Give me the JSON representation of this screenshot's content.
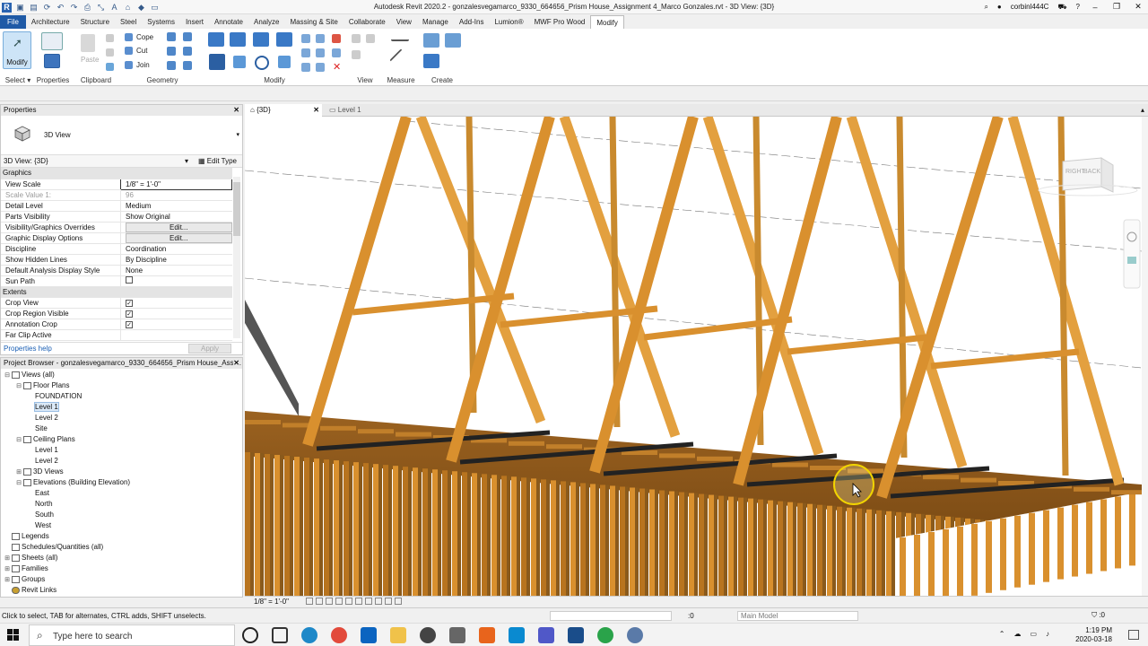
{
  "titlebar": {
    "title": "Autodesk Revit 2020.2 - gonzalesvegamarco_9330_664656_Prism House_Assignment 4_Marco Gonzales.rvt - 3D View: {3D}",
    "user": "corbinl444C"
  },
  "tabs": [
    "File",
    "Architecture",
    "Structure",
    "Steel",
    "Systems",
    "Insert",
    "Annotate",
    "Analyze",
    "Massing & Site",
    "Collaborate",
    "View",
    "Manage",
    "Add-Ins",
    "Lumion®",
    "MWF Pro Wood",
    "Modify"
  ],
  "ribbon": {
    "modify_label": "Modify",
    "panels": {
      "select": "Select ▾",
      "properties": "Properties",
      "clipboard": "Clipboard",
      "geometry": "Geometry",
      "modify": "Modify",
      "view": "View",
      "measure": "Measure",
      "create": "Create"
    },
    "paste": "Paste",
    "cope": "Cope",
    "cut": "Cut",
    "join": "Join"
  },
  "properties": {
    "header": "Properties",
    "type_name": "3D View",
    "instance_selector": "3D View: {3D}",
    "edit_type": "Edit Type",
    "groups": {
      "graphics": "Graphics",
      "extents": "Extents"
    },
    "rows_graphics": [
      {
        "name": "View Scale",
        "value": "1/8\" = 1'-0\""
      },
      {
        "name": "Scale Value    1:",
        "value": "96"
      },
      {
        "name": "Detail Level",
        "value": "Medium"
      },
      {
        "name": "Parts Visibility",
        "value": "Show Original"
      },
      {
        "name": "Visibility/Graphics Overrides",
        "value": "Edit..."
      },
      {
        "name": "Graphic Display Options",
        "value": "Edit..."
      },
      {
        "name": "Discipline",
        "value": "Coordination"
      },
      {
        "name": "Show Hidden Lines",
        "value": "By Discipline"
      },
      {
        "name": "Default Analysis Display Style",
        "value": "None"
      },
      {
        "name": "Sun Path",
        "value": ""
      }
    ],
    "rows_extents": [
      {
        "name": "Crop View",
        "value": "✓"
      },
      {
        "name": "Crop Region Visible",
        "value": "✓"
      },
      {
        "name": "Annotation Crop",
        "value": "✓"
      },
      {
        "name": "Far Clip Active",
        "value": ""
      }
    ],
    "help": "Properties help",
    "apply": "Apply"
  },
  "browser": {
    "header": "Project Browser - gonzalesvegamarco_9330_664656_Prism House_Assi...",
    "nodes": [
      {
        "label": "Views (all)",
        "toggle": "⊟",
        "indent": 0
      },
      {
        "label": "Floor Plans",
        "toggle": "⊟",
        "indent": 1
      },
      {
        "label": "FOUNDATION",
        "toggle": "",
        "indent": 2
      },
      {
        "label": "Level 1",
        "toggle": "",
        "indent": 2
      },
      {
        "label": "Level 2",
        "toggle": "",
        "indent": 2
      },
      {
        "label": "Site",
        "toggle": "",
        "indent": 2
      },
      {
        "label": "Ceiling Plans",
        "toggle": "⊟",
        "indent": 1
      },
      {
        "label": "Level 1",
        "toggle": "",
        "indent": 2
      },
      {
        "label": "Level 2",
        "toggle": "",
        "indent": 2
      },
      {
        "label": "3D Views",
        "toggle": "⊞",
        "indent": 1
      },
      {
        "label": "Elevations (Building Elevation)",
        "toggle": "⊟",
        "indent": 1
      },
      {
        "label": "East",
        "toggle": "",
        "indent": 2
      },
      {
        "label": "North",
        "toggle": "",
        "indent": 2
      },
      {
        "label": "South",
        "toggle": "",
        "indent": 2
      },
      {
        "label": "West",
        "toggle": "",
        "indent": 2
      },
      {
        "label": "Legends",
        "toggle": "",
        "indent": 0
      },
      {
        "label": "Schedules/Quantities (all)",
        "toggle": "",
        "indent": 0
      },
      {
        "label": "Sheets (all)",
        "toggle": "⊞",
        "indent": 0
      },
      {
        "label": "Families",
        "toggle": "⊞",
        "indent": 0
      },
      {
        "label": "Groups",
        "toggle": "⊞",
        "indent": 0
      },
      {
        "label": "Revit Links",
        "toggle": "",
        "indent": 0
      }
    ]
  },
  "views": {
    "active_tab": "{3D}",
    "other_tab": "Level 1",
    "viewcube_right": "RIGHT",
    "viewcube_back": "BACK"
  },
  "viewctrl": {
    "scale": "1/8\" = 1'-0\""
  },
  "status": {
    "message": "Click to select, TAB for alternates, CTRL adds, SHIFT unselects.",
    "zero": ":0",
    "model": "Main Model"
  },
  "taskbar": {
    "search": "Type here to search",
    "time": "1:19 PM",
    "date": "2020-03-18"
  },
  "colors": {
    "wood": "#d9902e",
    "wood_dark": "#8a5a1c",
    "floor": "#a86a24",
    "accent": "#1f5aa6"
  }
}
